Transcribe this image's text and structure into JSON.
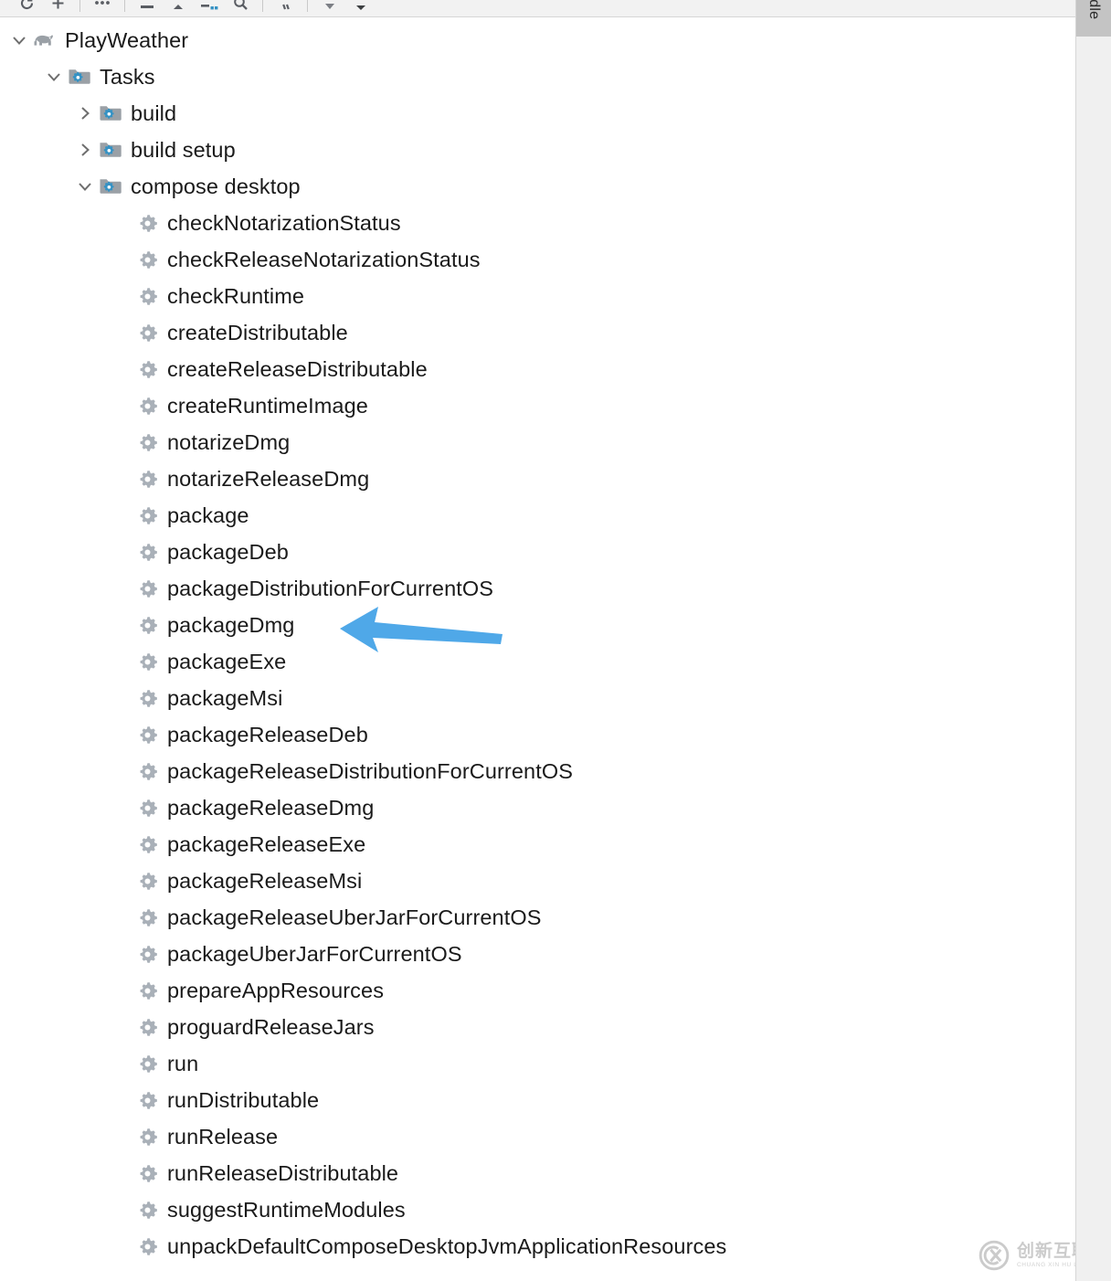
{
  "toolbar": {
    "buttons": [
      {
        "name": "refresh-icon",
        "title": "Reload All Gradle Projects"
      },
      {
        "name": "plus-icon",
        "title": "Link Gradle Project"
      },
      {
        "name": "more-icon",
        "title": "More"
      },
      {
        "name": "collapse-all-icon",
        "title": "Collapse All"
      },
      {
        "name": "expand-up-icon",
        "title": "Expand"
      },
      {
        "name": "group-tasks-icon",
        "title": "Group Tasks"
      },
      {
        "name": "search-icon",
        "title": "Search"
      },
      {
        "name": "toggle-offline-icon",
        "title": "Toggle Offline Mode"
      },
      {
        "name": "filter-dropdown-icon",
        "title": "Show Options Menu"
      }
    ]
  },
  "right_stripe": {
    "tab_label": "Gradle"
  },
  "tree": {
    "root": {
      "label": "PlayWeather",
      "icon": "gradle-elephant-icon",
      "expanded": true
    },
    "nodes": [
      {
        "label": "PlayWeather",
        "depth": 0,
        "icon": "gradle-elephant-icon",
        "twisty": "down"
      },
      {
        "label": "Tasks",
        "depth": 1,
        "icon": "task-folder-icon",
        "twisty": "down"
      },
      {
        "label": "build",
        "depth": 2,
        "icon": "task-folder-icon",
        "twisty": "right"
      },
      {
        "label": "build setup",
        "depth": 2,
        "icon": "task-folder-icon",
        "twisty": "right"
      },
      {
        "label": "compose desktop",
        "depth": 2,
        "icon": "task-folder-icon",
        "twisty": "down"
      },
      {
        "label": "checkNotarizationStatus",
        "depth": 3,
        "icon": "gear-icon",
        "twisty": "none"
      },
      {
        "label": "checkReleaseNotarizationStatus",
        "depth": 3,
        "icon": "gear-icon",
        "twisty": "none"
      },
      {
        "label": "checkRuntime",
        "depth": 3,
        "icon": "gear-icon",
        "twisty": "none"
      },
      {
        "label": "createDistributable",
        "depth": 3,
        "icon": "gear-icon",
        "twisty": "none"
      },
      {
        "label": "createReleaseDistributable",
        "depth": 3,
        "icon": "gear-icon",
        "twisty": "none"
      },
      {
        "label": "createRuntimeImage",
        "depth": 3,
        "icon": "gear-icon",
        "twisty": "none"
      },
      {
        "label": "notarizeDmg",
        "depth": 3,
        "icon": "gear-icon",
        "twisty": "none"
      },
      {
        "label": "notarizeReleaseDmg",
        "depth": 3,
        "icon": "gear-icon",
        "twisty": "none"
      },
      {
        "label": "package",
        "depth": 3,
        "icon": "gear-icon",
        "twisty": "none"
      },
      {
        "label": "packageDeb",
        "depth": 3,
        "icon": "gear-icon",
        "twisty": "none"
      },
      {
        "label": "packageDistributionForCurrentOS",
        "depth": 3,
        "icon": "gear-icon",
        "twisty": "none"
      },
      {
        "label": "packageDmg",
        "depth": 3,
        "icon": "gear-icon",
        "twisty": "none"
      },
      {
        "label": "packageExe",
        "depth": 3,
        "icon": "gear-icon",
        "twisty": "none"
      },
      {
        "label": "packageMsi",
        "depth": 3,
        "icon": "gear-icon",
        "twisty": "none"
      },
      {
        "label": "packageReleaseDeb",
        "depth": 3,
        "icon": "gear-icon",
        "twisty": "none"
      },
      {
        "label": "packageReleaseDistributionForCurrentOS",
        "depth": 3,
        "icon": "gear-icon",
        "twisty": "none"
      },
      {
        "label": "packageReleaseDmg",
        "depth": 3,
        "icon": "gear-icon",
        "twisty": "none"
      },
      {
        "label": "packageReleaseExe",
        "depth": 3,
        "icon": "gear-icon",
        "twisty": "none"
      },
      {
        "label": "packageReleaseMsi",
        "depth": 3,
        "icon": "gear-icon",
        "twisty": "none"
      },
      {
        "label": "packageReleaseUberJarForCurrentOS",
        "depth": 3,
        "icon": "gear-icon",
        "twisty": "none"
      },
      {
        "label": "packageUberJarForCurrentOS",
        "depth": 3,
        "icon": "gear-icon",
        "twisty": "none"
      },
      {
        "label": "prepareAppResources",
        "depth": 3,
        "icon": "gear-icon",
        "twisty": "none"
      },
      {
        "label": "proguardReleaseJars",
        "depth": 3,
        "icon": "gear-icon",
        "twisty": "none"
      },
      {
        "label": "run",
        "depth": 3,
        "icon": "gear-icon",
        "twisty": "none"
      },
      {
        "label": "runDistributable",
        "depth": 3,
        "icon": "gear-icon",
        "twisty": "none"
      },
      {
        "label": "runRelease",
        "depth": 3,
        "icon": "gear-icon",
        "twisty": "none"
      },
      {
        "label": "runReleaseDistributable",
        "depth": 3,
        "icon": "gear-icon",
        "twisty": "none"
      },
      {
        "label": "suggestRuntimeModules",
        "depth": 3,
        "icon": "gear-icon",
        "twisty": "none"
      },
      {
        "label": "unpackDefaultComposeDesktopJvmApplicationResources",
        "depth": 3,
        "icon": "gear-icon",
        "twisty": "none"
      }
    ]
  },
  "annotation": {
    "arrow": {
      "name": "annotation-arrow",
      "direction": "left",
      "color": "#4FA8E8",
      "points_at": "packageDmg"
    }
  },
  "watermark": {
    "cn": "创新互联",
    "en": "CHUANG XIN HU LIAN",
    "logo": "cx-circle-logo"
  },
  "colors": {
    "background": "#ffffff",
    "toolbar_bg": "#f2f2f2",
    "stripe_bg": "#f0f0f0",
    "tab_active_bg": "#c4c4c4",
    "text": "#1a1a1a",
    "icon_gray": "#9aa0a6",
    "icon_blue": "#3592C4",
    "accent_arrow": "#4FA8E8"
  }
}
